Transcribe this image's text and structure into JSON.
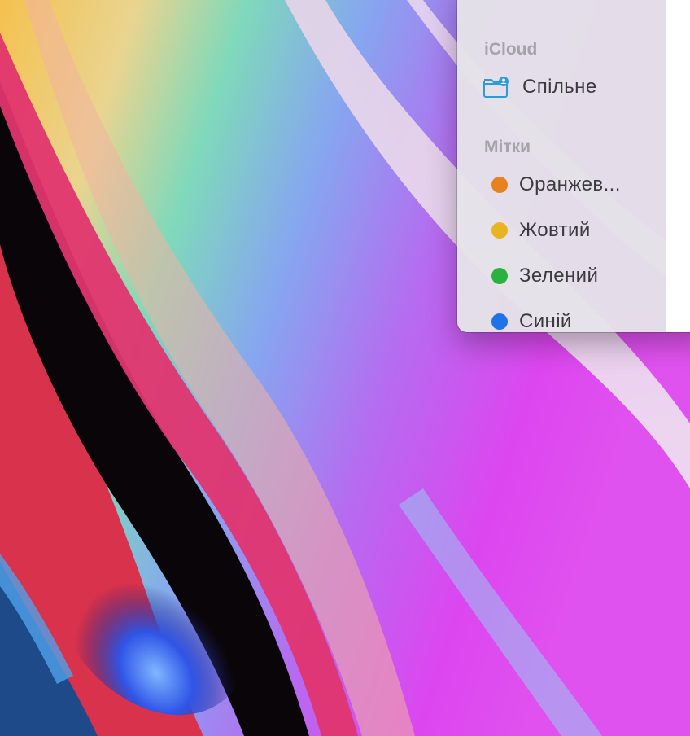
{
  "sidebar": {
    "icloud_section": {
      "title": "iCloud",
      "items": [
        {
          "label": "Спільне",
          "icon": "shared-folder-icon"
        }
      ]
    },
    "tags_section": {
      "title": "Мітки",
      "items": [
        {
          "label": "Оранжев...",
          "color": "#e8821e"
        },
        {
          "label": "Жовтий",
          "color": "#e8b420"
        },
        {
          "label": "Зелений",
          "color": "#2bb23e"
        },
        {
          "label": "Синій",
          "color": "#1e73e8"
        }
      ]
    }
  }
}
